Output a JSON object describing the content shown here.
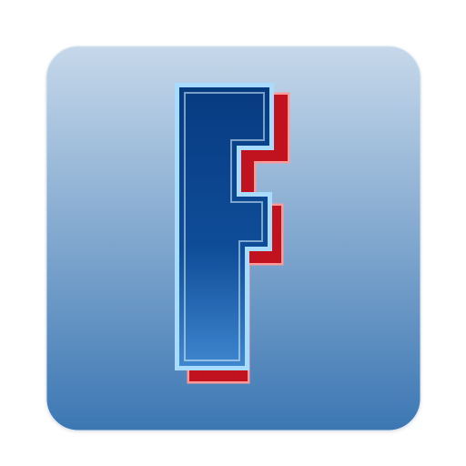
{
  "app_icon": {
    "letter": "F",
    "colors": {
      "tile_top": "#c6d8ea",
      "tile_bottom": "#3c77b3",
      "letter_top": "#073b80",
      "letter_bottom": "#3f86cf",
      "letter_outline": "#a9dbff",
      "shadow": "#c1121f",
      "shadow_outline": "#ff9a9a"
    },
    "icons": [
      "app-tile-icon",
      "letter-f-logo"
    ]
  }
}
